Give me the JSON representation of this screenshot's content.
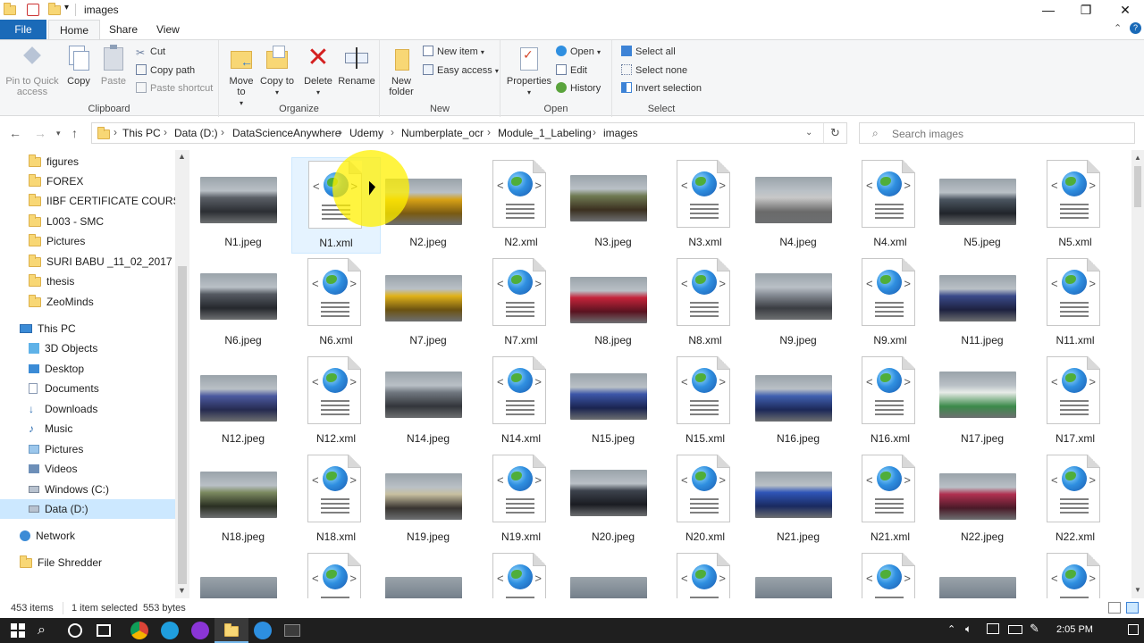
{
  "window": {
    "title": "images"
  },
  "tabs": {
    "file": "File",
    "home": "Home",
    "share": "Share",
    "view": "View"
  },
  "ribbon": {
    "clipboard": {
      "label": "Clipboard",
      "pin": "Pin to Quick access",
      "copy": "Copy",
      "paste": "Paste",
      "cut": "Cut",
      "copy_path": "Copy path",
      "paste_shortcut": "Paste shortcut"
    },
    "organize": {
      "label": "Organize",
      "move_to": "Move to",
      "copy_to": "Copy to",
      "delete": "Delete",
      "rename": "Rename"
    },
    "new": {
      "label": "New",
      "new_folder": "New folder",
      "new_item": "New item",
      "easy_access": "Easy access"
    },
    "open": {
      "label": "Open",
      "properties": "Properties",
      "open": "Open",
      "edit": "Edit",
      "history": "History"
    },
    "select": {
      "label": "Select",
      "select_all": "Select all",
      "select_none": "Select none",
      "invert": "Invert selection"
    }
  },
  "address": {
    "crumbs": [
      "This PC",
      "Data (D:)",
      "DataScienceAnywhere",
      "Udemy",
      "Numberplate_ocr",
      "Module_1_Labeling",
      "images"
    ],
    "search_placeholder": "Search images"
  },
  "sidebar": {
    "folders": [
      "figures",
      "FOREX",
      "IIBF CERTIFICATE COURSE",
      "L003 - SMC",
      "Pictures",
      "SURI BABU _11_02_2017",
      "thesis",
      "ZeoMinds"
    ],
    "this_pc": "This PC",
    "pc_items": [
      "3D Objects",
      "Desktop",
      "Documents",
      "Downloads",
      "Music",
      "Pictures",
      "Videos",
      "Windows (C:)",
      "Data (D:)"
    ],
    "network": "Network",
    "file_shredder": "File Shredder"
  },
  "files": [
    [
      "N1.jpeg",
      "N1.xml",
      "N2.jpeg",
      "N2.xml",
      "N3.jpeg",
      "N3.xml",
      "N4.jpeg",
      "N4.xml",
      "N5.jpeg",
      "N5.xml"
    ],
    [
      "N6.jpeg",
      "N6.xml",
      "N7.jpeg",
      "N7.xml",
      "N8.jpeg",
      "N8.xml",
      "N9.jpeg",
      "N9.xml",
      "N11.jpeg",
      "N11.xml"
    ],
    [
      "N12.jpeg",
      "N12.xml",
      "N14.jpeg",
      "N14.xml",
      "N15.jpeg",
      "N15.xml",
      "N16.jpeg",
      "N16.xml",
      "N17.jpeg",
      "N17.xml"
    ],
    [
      "N18.jpeg",
      "N18.xml",
      "N19.jpeg",
      "N19.xml",
      "N20.jpeg",
      "N20.xml",
      "N21.jpeg",
      "N21.xml",
      "N22.jpeg",
      "N22.xml"
    ]
  ],
  "status": {
    "items": "453 items",
    "selected": "1 item selected",
    "size": "553 bytes"
  },
  "clock": {
    "time": "2:05 PM"
  }
}
